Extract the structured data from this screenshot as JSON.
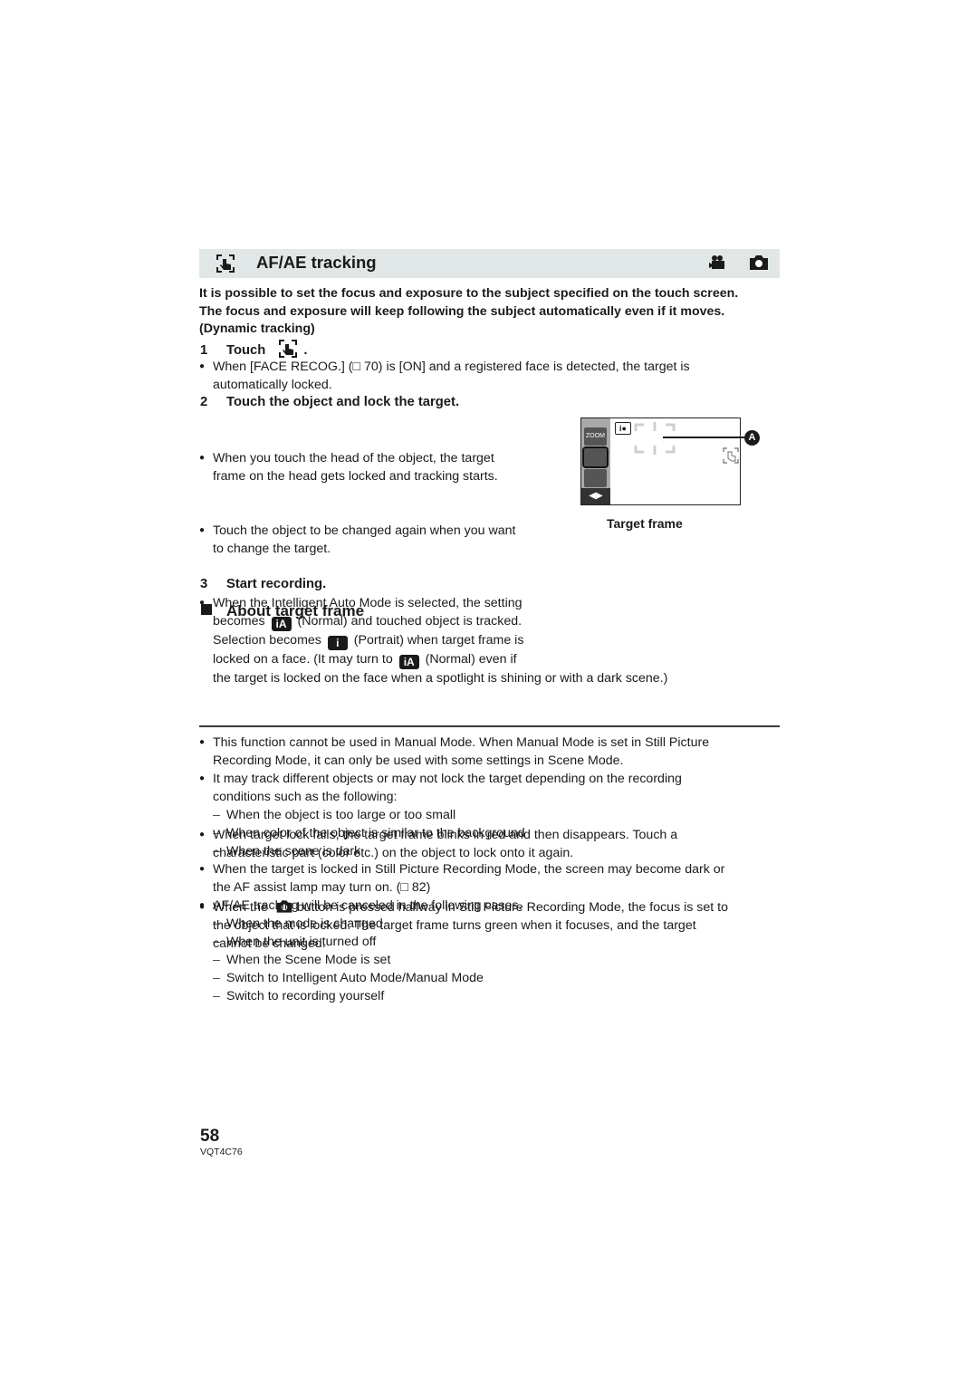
{
  "header": {
    "title": "AF/AE tracking",
    "icon_left": "touch-tracking-icon",
    "mode_icons": [
      "video-camera-icon",
      "still-camera-icon"
    ]
  },
  "intro": {
    "lines": [
      "It is possible to set the focus and exposure to the subject specified on the touch screen.",
      "The focus and exposure will keep following the subject automatically even if it moves.",
      "(Dynamic tracking)"
    ]
  },
  "steps": {
    "step1": {
      "num": "1",
      "label": "Touch",
      "suffix": "."
    },
    "step1_note": {
      "lines": [
        "When [FACE RECOG.] (□ 70) is [ON] and a registered face is detected, the target is",
        "automatically locked."
      ]
    },
    "step2": {
      "num": "2",
      "label": "Touch the object and lock the target."
    },
    "step2_notes": [
      {
        "lines": [
          "When you touch the head of the object, the target",
          "frame on the head gets locked and tracking starts."
        ]
      },
      {
        "lines": [
          "Touch the object to be changed again when you want",
          "to change the target."
        ]
      },
      {
        "line1": "When the Intelligent Auto Mode is selected, the setting",
        "line2a": "becomes",
        "line2b": "(Normal) and touched object is tracked.",
        "line3a": "Selection becomes",
        "line3b": "(Portrait) when target frame is",
        "line4a": "locked on a face. (It may turn to",
        "line4b": "(Normal) even if",
        "line5": "the target is locked on the face when a spotlight is shining or with a dark scene.)",
        "icon_normal": "iA",
        "icon_portrait": "i"
      }
    ],
    "step3": {
      "num": "3",
      "label": "Start recording."
    }
  },
  "illustration": {
    "caption": "Target frame",
    "callout": "A",
    "side_buttons": [
      "ZOOM",
      "",
      ""
    ]
  },
  "about": {
    "title": "About target frame",
    "notes": [
      {
        "lines": [
          "When target lock fails, the target frame blinks in red and then disappears. Touch a",
          "characteristic part (color etc.) on the object to lock onto it again."
        ]
      },
      {
        "line1a": "When the",
        "line1b": "button is pressed halfway in Still Picture Recording Mode, the focus is set to",
        "line2": "the object that is locked. The target frame turns green when it focuses, and the target",
        "line3": "cannot be changed."
      }
    ]
  },
  "notes": {
    "items": [
      {
        "lines": [
          "This function cannot be used in Manual Mode. When Manual Mode is set in Still Picture",
          "Recording Mode, it can only be used with some settings in Scene Mode."
        ]
      },
      {
        "lines": [
          "It may track different objects or may not lock the target depending on the recording",
          "conditions such as the following:"
        ]
      }
    ],
    "conditions": [
      "When the object is too large or too small",
      "When color of the object is similar to the background",
      "When the scene is dark"
    ],
    "items2": [
      {
        "lines": [
          "When the target is locked in Still Picture Recording Mode, the screen may become dark or",
          "the AF assist lamp may turn on. (□ 82)"
        ]
      },
      {
        "lines": [
          "AF/AE tracking will be canceled in the following cases."
        ]
      }
    ],
    "cancel_cases": [
      "When the mode is changed",
      "When the unit is turned off",
      "When the Scene Mode is set",
      "Switch to Intelligent Auto Mode/Manual Mode",
      "Switch to recording yourself"
    ]
  },
  "footer": {
    "page_number": "58",
    "model_code": "VQT4C76"
  }
}
